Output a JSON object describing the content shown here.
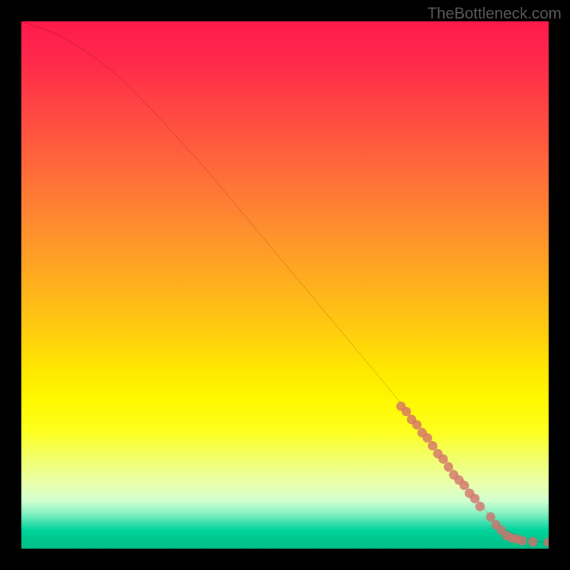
{
  "watermark": "TheBottleneck.com",
  "chart_data": {
    "type": "line",
    "title": "",
    "xlabel": "",
    "ylabel": "",
    "xlim": [
      0,
      100
    ],
    "ylim": [
      0,
      100
    ],
    "background": "vertical gradient red→orange→yellow→green (red top, green bottom)",
    "series": [
      {
        "name": "curve",
        "type": "line",
        "x": [
          0,
          3,
          7,
          12,
          18,
          25,
          35,
          45,
          55,
          65,
          75,
          82,
          86,
          89,
          91,
          93,
          95,
          97,
          99,
          100
        ],
        "y": [
          100,
          99,
          97.5,
          94.5,
          90,
          83,
          72,
          60,
          48,
          36,
          24,
          15,
          10,
          6,
          4,
          3,
          2,
          1.5,
          1.2,
          1.2
        ]
      },
      {
        "name": "points",
        "type": "scatter",
        "color": "#d4706a",
        "x": [
          72,
          73,
          74,
          75,
          76,
          77,
          78,
          79,
          80,
          81,
          82,
          83,
          84,
          85,
          86,
          87,
          89,
          90,
          91,
          92,
          93,
          94,
          95,
          97,
          100
        ],
        "y": [
          27,
          26,
          24.5,
          23.5,
          22,
          21,
          19.5,
          18,
          17,
          15.5,
          14,
          13,
          12,
          10.5,
          9.5,
          8,
          6,
          4.5,
          3.5,
          2.5,
          2,
          1.8,
          1.5,
          1.3,
          1.2
        ]
      }
    ]
  }
}
